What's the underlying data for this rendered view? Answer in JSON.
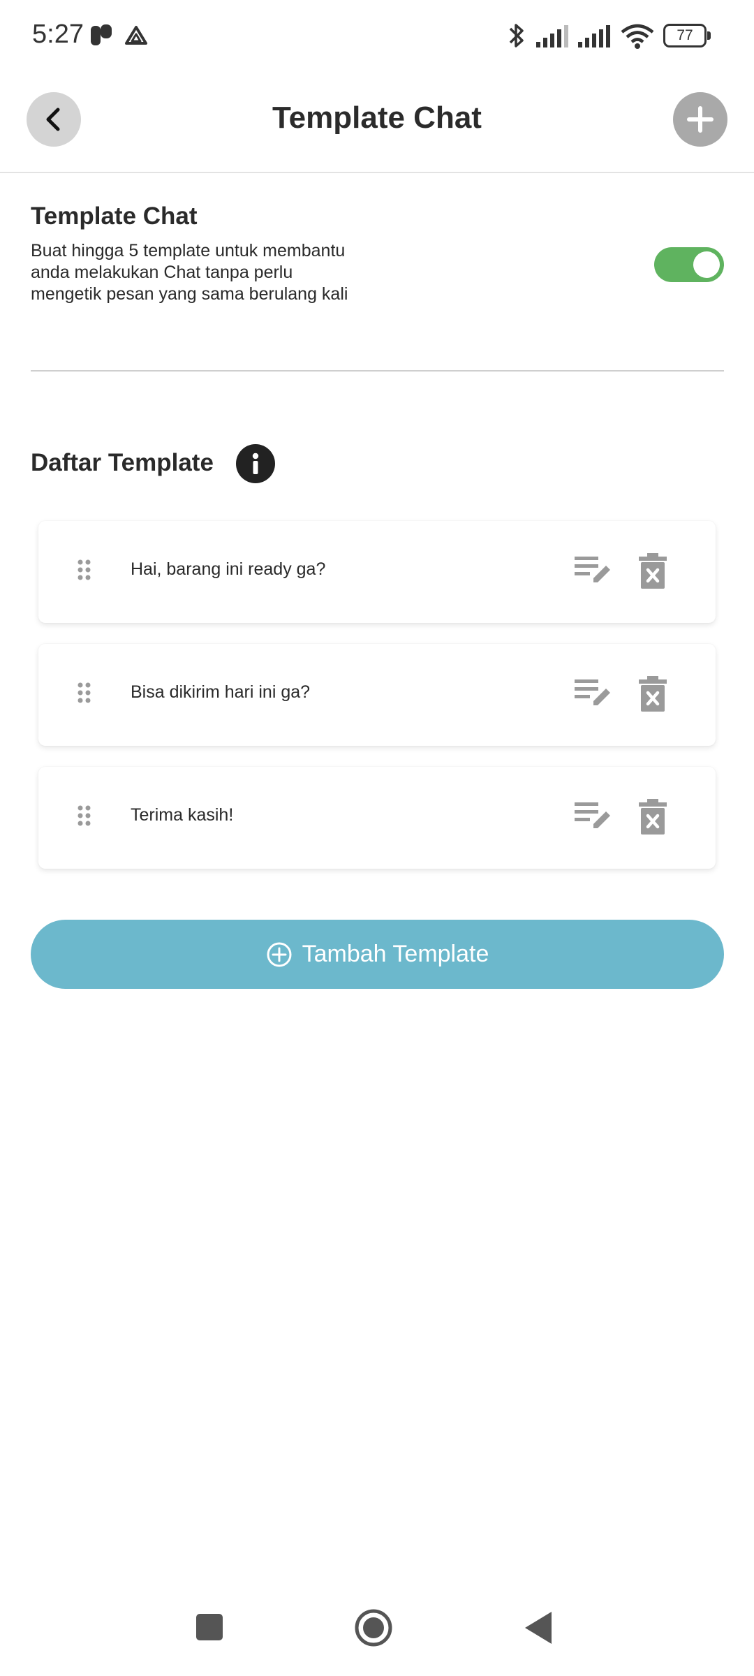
{
  "status_bar": {
    "time": "5:27",
    "battery": "77",
    "icons": [
      "app-icon",
      "drive-icon",
      "bluetooth-icon",
      "signal-icon",
      "signal-icon",
      "wifi-icon",
      "battery-icon"
    ]
  },
  "app_bar": {
    "title": "Template Chat",
    "back_icon": "chevron-left-icon",
    "add_icon": "plus-icon"
  },
  "settings": {
    "title": "Template Chat",
    "description": "Buat hingga 5 template untuk membantu anda melakukan Chat tanpa perlu mengetik pesan yang sama berulang kali",
    "toggle_on": true,
    "toggle_color": "#5fb35f"
  },
  "templates_section": {
    "title": "Daftar Template",
    "info_icon": "info-icon",
    "items": [
      {
        "text": "Hai, barang ini ready ga?"
      },
      {
        "text": "Bisa dikirim hari ini ga?"
      },
      {
        "text": "Terima kasih!"
      }
    ]
  },
  "add_button": {
    "label": "Tambah Template",
    "icon": "plus-circle-icon",
    "color": "#6cb8cc"
  },
  "nav_bar": {
    "icons": [
      "recents-icon",
      "home-icon",
      "back-icon"
    ]
  }
}
